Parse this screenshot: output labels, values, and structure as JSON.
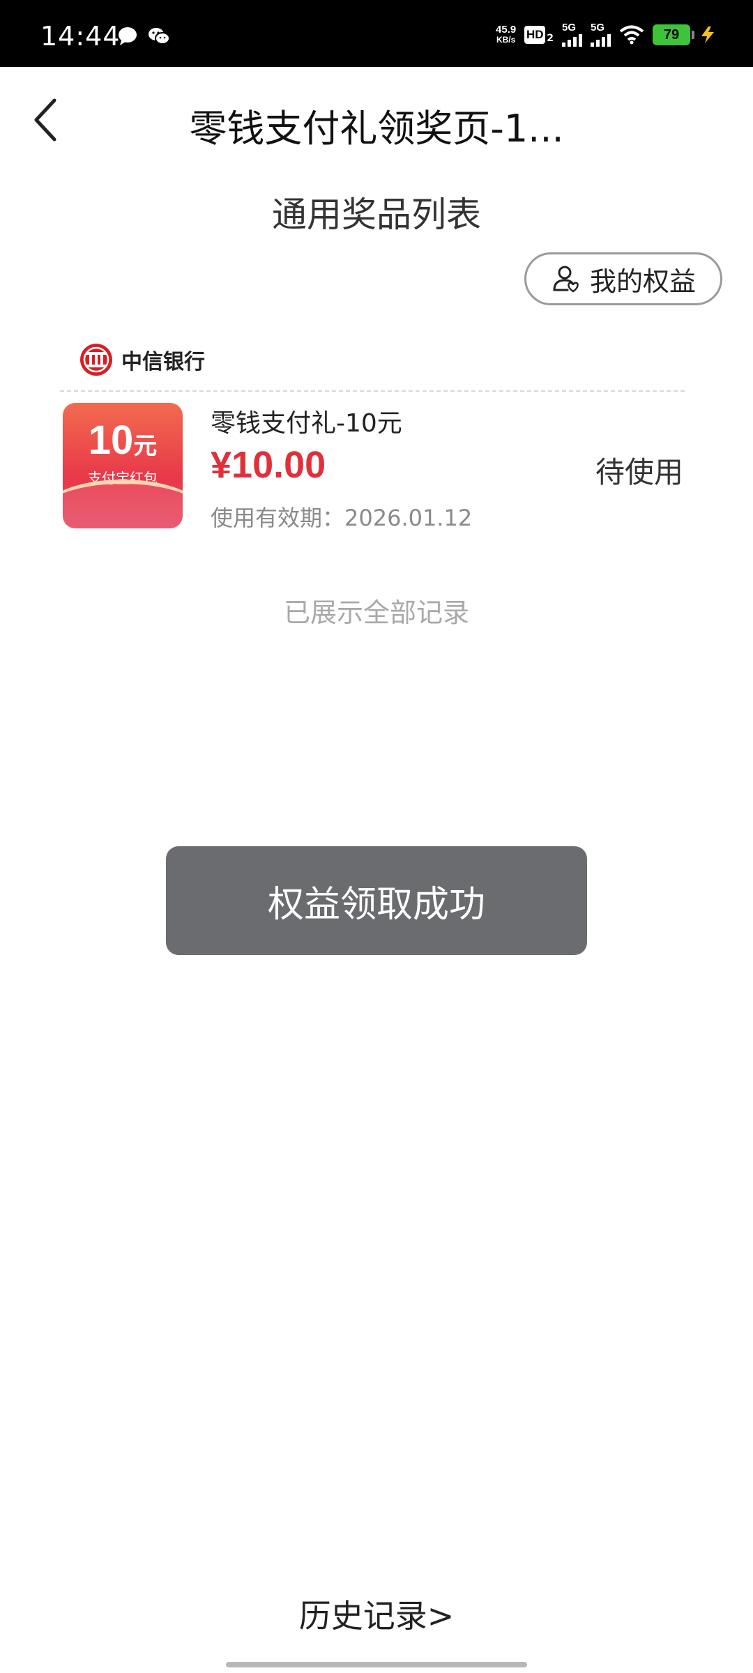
{
  "status_bar": {
    "time": "14:44",
    "net_speed_value": "45.9",
    "net_speed_unit": "KB/s",
    "hd_label": "HD",
    "hd_sub": "2",
    "signal1_label": "5G",
    "signal2_label": "5G",
    "battery_level": "79"
  },
  "header": {
    "title": "零钱支付礼领奖页-1..."
  },
  "list": {
    "title": "通用奖品列表",
    "my_rights_label": "我的权益",
    "bank_name": "中信银行",
    "items": [
      {
        "thumb_amount": "10",
        "thumb_unit": "元",
        "thumb_label": "支付宝红包",
        "name": "零钱支付礼-10元",
        "price": "¥10.00",
        "expiry": "使用有效期：2026.01.12",
        "status": "待使用"
      }
    ],
    "end_text": "已展示全部记录"
  },
  "toast": {
    "message": "权益领取成功"
  },
  "footer": {
    "history_link": "历史记录>"
  },
  "colors": {
    "price_red": "#e0303a",
    "toast_bg": "#6b6c70",
    "battery_green": "#3ec43a",
    "bank_red": "#d71f26"
  }
}
